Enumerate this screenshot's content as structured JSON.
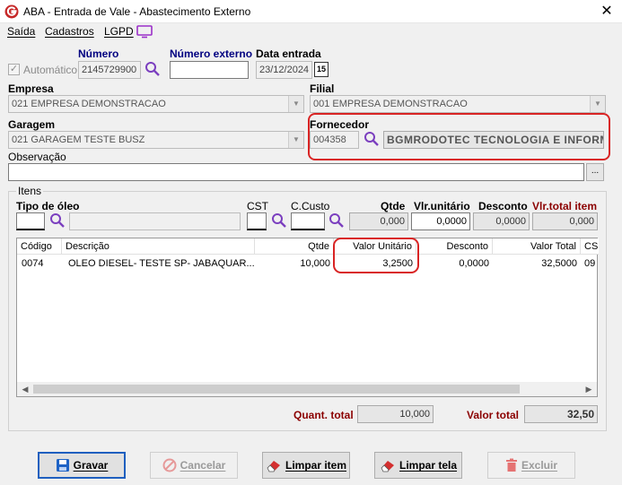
{
  "window": {
    "title": "ABA - Entrada de Vale - Abastecimento Externo",
    "close_glyph": "✕"
  },
  "menu": [
    {
      "label": "Saída"
    },
    {
      "label": "Cadastros"
    },
    {
      "label": "LGPD"
    }
  ],
  "header": {
    "automatico_label": "Automático",
    "numero_label": "Número",
    "numero_value": "2145729900",
    "numero_externo_label": "Número externo",
    "numero_externo_value": "",
    "data_entrada_label": "Data entrada",
    "data_entrada_value": "23/12/2024",
    "calendar_glyph": "15"
  },
  "empresa": {
    "label": "Empresa",
    "value": "021 EMPRESA DEMONSTRACAO"
  },
  "filial": {
    "label": "Filial",
    "value": "001 EMPRESA DEMONSTRACAO"
  },
  "garagem": {
    "label": "Garagem",
    "value": "021 GARAGEM TESTE BUSZ"
  },
  "fornecedor": {
    "label": "Fornecedor",
    "code": "004358",
    "name": "BGMRODOTEC TECNOLOGIA E INFORMA"
  },
  "observacao": {
    "label": "Observação",
    "value": "",
    "ellipsis": "..."
  },
  "itens": {
    "group_label": "Itens",
    "tipo_oleo_label": "Tipo de óleo",
    "cst_label": "CST",
    "ccusto_label": "C.Custo",
    "qtde_label": "Qtde",
    "vlr_unitario_label": "Vlr.unitário",
    "desconto_label": "Desconto",
    "vlr_total_item_label": "Vlr.total item",
    "qtde_value": "0,000",
    "vlr_unitario_value": "0,0000",
    "desconto_value": "0,0000",
    "vlr_total_item_value": "0,000"
  },
  "grid": {
    "columns": [
      "Código",
      "Descrição",
      "Qtde",
      "Valor Unitário",
      "Desconto",
      "Valor Total",
      "CS"
    ],
    "rows": [
      [
        "0074",
        "OLEO DIESEL- TESTE SP- JABAQUAR...",
        "10,000",
        "3,2500",
        "0,0000",
        "32,5000",
        "09"
      ]
    ]
  },
  "totals": {
    "quant_total_label": "Quant. total",
    "quant_total_value": "10,000",
    "valor_total_label": "Valor total",
    "valor_total_value": "32,50"
  },
  "buttons": {
    "gravar": "Gravar",
    "cancelar": "Cancelar",
    "limpar_item": "Limpar item",
    "limpar_tela": "Limpar tela",
    "excluir": "Excluir"
  },
  "colors": {
    "highlight": "#d92424",
    "label_navy": "#000080",
    "label_red": "#8b0000",
    "brand": "#c62828"
  }
}
